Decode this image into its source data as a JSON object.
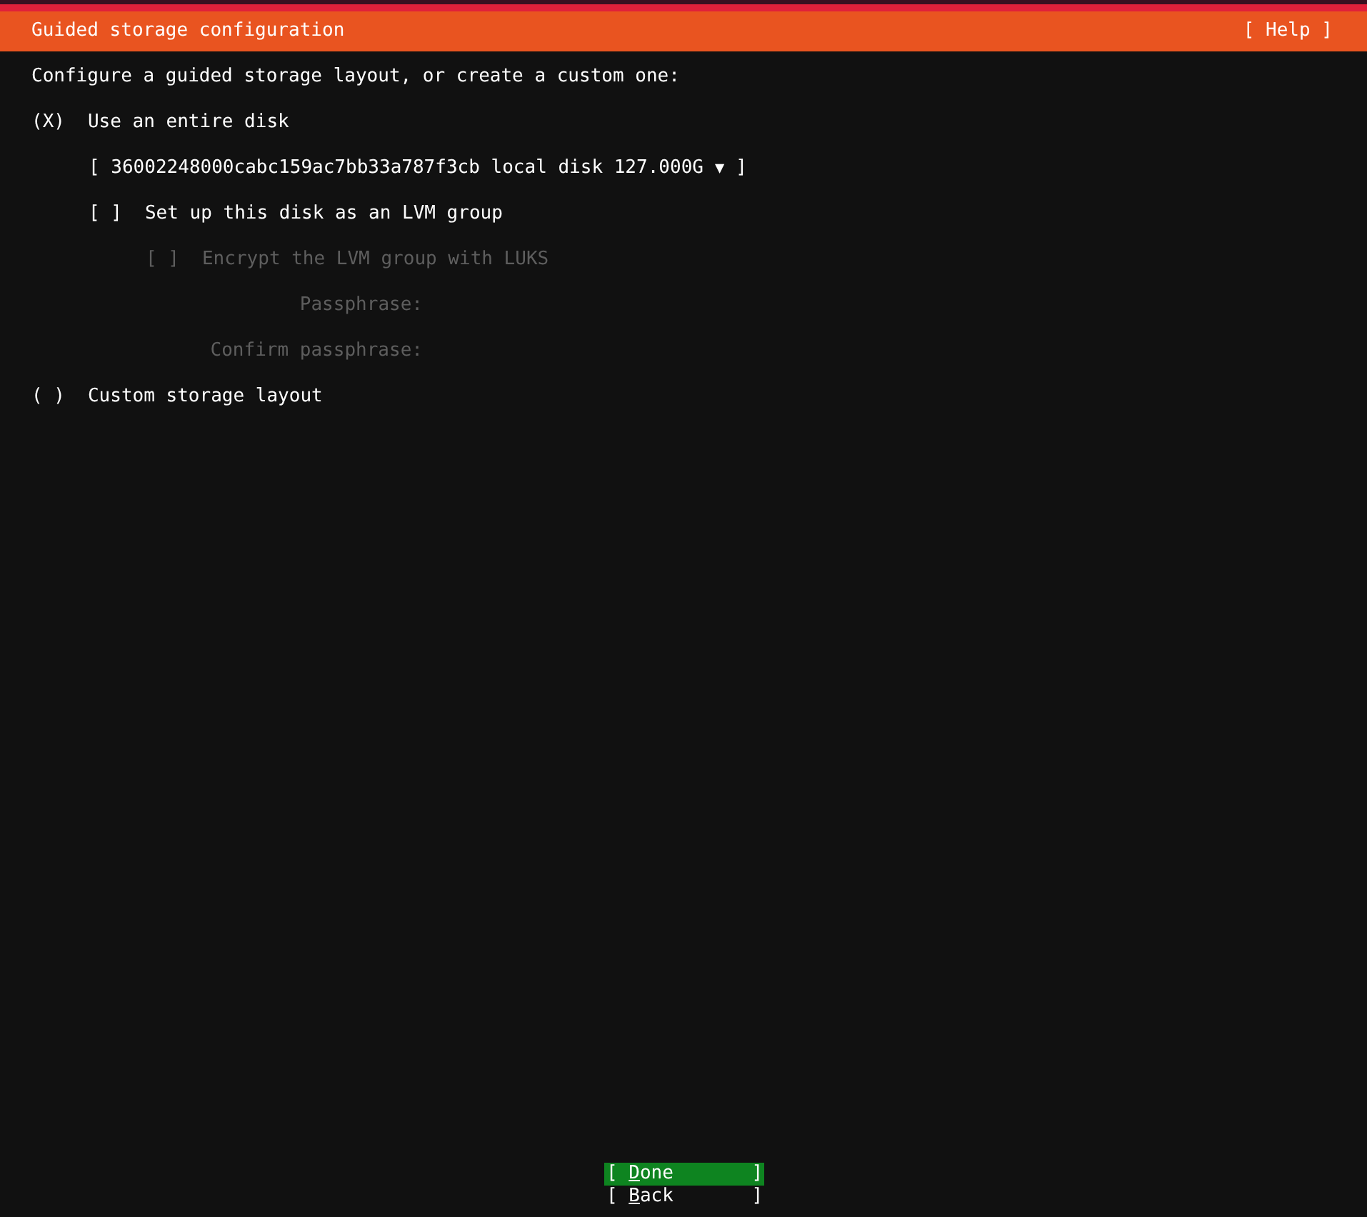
{
  "header": {
    "title": "Guided storage configuration",
    "help": "[ Help ]"
  },
  "intro": "Configure a guided storage layout, or create a custom one:",
  "radio_marks": {
    "on": "(X)",
    "off": "( )"
  },
  "disk_option": {
    "label": "Use an entire disk",
    "selected": true
  },
  "disk_dropdown": {
    "value": "[ 36002248000cabc159ac7bb33a787f3cb local disk 127.000G",
    "arrow": "▼",
    "close": "]"
  },
  "lvm": {
    "box": "[ ]",
    "label": "Set up this disk as an LVM group",
    "checked": false
  },
  "encrypt": {
    "box": "[ ]",
    "label": "Encrypt the LVM group with LUKS",
    "checked": false,
    "disabled": true
  },
  "passphrase_fields": [
    {
      "label": "Passphrase:",
      "disabled": true
    },
    {
      "label": "Confirm passphrase:",
      "disabled": true
    }
  ],
  "custom_option": {
    "label": "Custom storage layout",
    "selected": false
  },
  "buttons": [
    {
      "label": "[ Done       ]",
      "selected": true
    },
    {
      "label": "[ Back       ]",
      "selected": false
    }
  ]
}
